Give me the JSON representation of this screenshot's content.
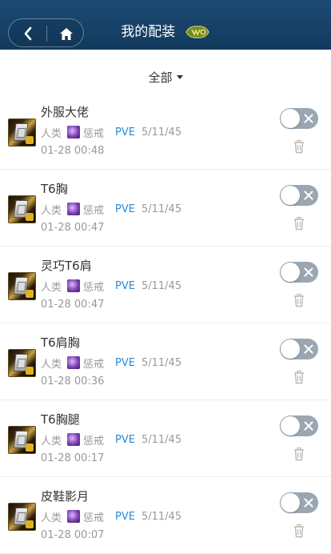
{
  "header": {
    "title": "我的配装",
    "back_icon": "chevron-left-icon",
    "home_icon": "home-icon",
    "logo_icon": "wow-classic-logo-icon",
    "bg_color": "#16406a"
  },
  "filter": {
    "label": "全部",
    "icon": "caret-down-icon"
  },
  "items": [
    {
      "name": "外服大佬",
      "race": "人类",
      "spec": "惩戒",
      "mode": "PVE",
      "ilvl": "5/11/45",
      "time": "01-28 00:48"
    },
    {
      "name": "T6胸",
      "race": "人类",
      "spec": "惩戒",
      "mode": "PVE",
      "ilvl": "5/11/45",
      "time": "01-28 00:47"
    },
    {
      "name": "灵巧T6肩",
      "race": "人类",
      "spec": "惩戒",
      "mode": "PVE",
      "ilvl": "5/11/45",
      "time": "01-28 00:47"
    },
    {
      "name": "T6肩胸",
      "race": "人类",
      "spec": "惩戒",
      "mode": "PVE",
      "ilvl": "5/11/45",
      "time": "01-28 00:36"
    },
    {
      "name": "T6胸腿",
      "race": "人类",
      "spec": "惩戒",
      "mode": "PVE",
      "ilvl": "5/11/45",
      "time": "01-28 00:17"
    },
    {
      "name": "皮鞋影月",
      "race": "人类",
      "spec": "惩戒",
      "mode": "PVE",
      "ilvl": "5/11/45",
      "time": "01-28 00:07"
    }
  ],
  "colors": {
    "accent": "#2a8ad4",
    "toggle_off": "#9aa7b2",
    "muted_text": "#999999"
  }
}
